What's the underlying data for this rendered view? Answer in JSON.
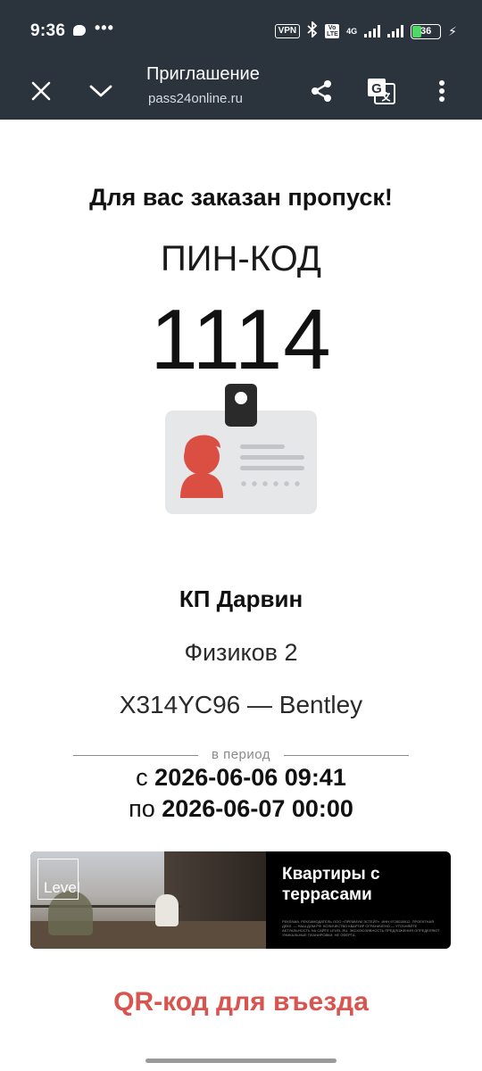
{
  "status_bar": {
    "time": "9:36",
    "dots": "•••",
    "vpn": "VPN",
    "volte": "Vo LTE",
    "network": "4G",
    "battery": "36",
    "battery_level": 0.36,
    "charging_symbol": "⚡"
  },
  "toolbar": {
    "title": "Приглашение",
    "url": "pass24online.ru",
    "icons": [
      "close-icon",
      "chevron-down-icon",
      "share-icon",
      "translate-icon",
      "more-vert-icon"
    ]
  },
  "pass": {
    "headline": "Для вас заказан пропуск!",
    "pin_label": "ПИН-КОД",
    "pin_code": "1114",
    "place": "КП Дарвин",
    "address": "Физиков 2",
    "vehicle": "Х314YC96 — Bentley",
    "period_label": "в период",
    "from_prefix": "с",
    "from_value": "2026-06-06 09:41",
    "to_prefix": "по",
    "to_value": "2026-06-07 00:00"
  },
  "ad": {
    "logo": "Level",
    "title": "Квартиры с террасами",
    "fine_print": "РЕКЛАМА. РЕКЛАМОДАТЕЛЬ ООО «ПРЕМИУМ ЭСТЕЙТ». ИНН 9728028912. ПРОЕКТНАЯ ДЕКЛ. — НАШ.ДОМ.РФ. КОЛИЧЕСТВО КВАРТИР ОГРАНИЧЕНО — УТОЧНЯЙТЕ АКТУАЛЬНОСТЬ НА САЙТЕ LEVEL.RU. ЭКСКЛЮЗИВНОСТЬ ПРЕДЛОЖЕНИЯ ОПРЕДЕЛЯЮТ УНИКАЛЬНЫЕ ПЛАНИРОВКИ, НЕ ОФЕРТА."
  },
  "qr_link": "QR-код для въезда",
  "colors": {
    "toolbar_bg": "#2b333d",
    "accent_red": "#d9534f",
    "badge_card": "#e6e7e9",
    "badge_avatar": "#db4f43"
  }
}
